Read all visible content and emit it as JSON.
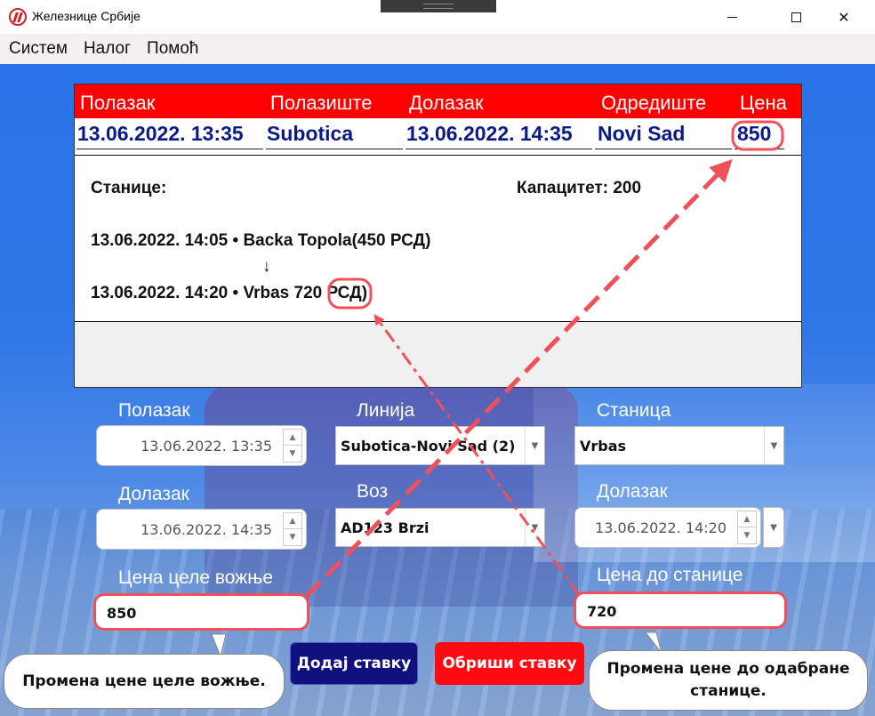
{
  "window": {
    "title": "Железнице Србије",
    "logo_icon": "railway-logo-icon"
  },
  "menu": {
    "items": [
      "Систем",
      "Налог",
      "Помоћ"
    ]
  },
  "ticket": {
    "headers": [
      "Полазак",
      "Полазиште",
      "Долазак",
      "Одредиште",
      "Цена"
    ],
    "row": {
      "departure": "13.06.2022. 13:35",
      "origin": "Subotica",
      "arrival": "13.06.2022. 14:35",
      "destination": "Novi Sad",
      "price": "850"
    },
    "stations_label": "Станице:",
    "capacity": "Капацитет: 200",
    "stop1": "13.06.2022. 14:05 • Backa Topola(450 РСД)",
    "arrow": "↓",
    "stop2_prefix": "13.06.2022. 14:20 • Vrbas ",
    "stop2_price": "720",
    "stop2_suffix": " РСД)"
  },
  "form": {
    "departure_label": "Полазак",
    "departure_value": "13.06.2022. 13:35",
    "arrival_label": "Долазак",
    "arrival_value": "13.06.2022. 14:35",
    "line_label": "Линија",
    "line_value": "Subotica-Novi Sad (2)",
    "train_label": "Воз",
    "train_value": "AD123 Brzi",
    "station_label": "Станица",
    "station_value": "Vrbas",
    "station_arrival_label": "Долазак",
    "station_arrival_value": "13.06.2022. 14:20",
    "full_price_label": "Цена целе вожње",
    "full_price_value": "850",
    "station_price_label": "Цена до станице",
    "station_price_value": "720"
  },
  "buttons": {
    "add": "Додај ставку",
    "delete": "Обриши ставку"
  },
  "callouts": {
    "left": "Промена цене целе вожње.",
    "right_line1": "Промена цене до одабране",
    "right_line2": "станице."
  },
  "colors": {
    "header_red": "#ff0000",
    "accent_blue": "#0a1a8a",
    "highlight": "#f0505a",
    "add_button": "#10107e",
    "delete_button": "#ff0a10"
  }
}
